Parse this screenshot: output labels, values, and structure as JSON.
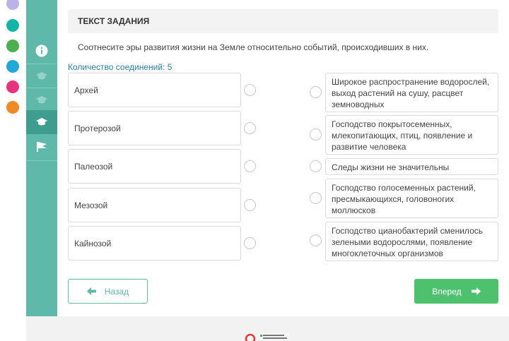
{
  "app_rail": {
    "icons": [
      "app-icon-1",
      "app-icon-2",
      "app-icon-3",
      "app-icon-4",
      "app-icon-5",
      "app-icon-6"
    ],
    "colors": [
      "#b9b3e6",
      "#15b3a3",
      "#4caf50",
      "#1fa8d8",
      "#e6347a",
      "#f08a24"
    ]
  },
  "task_nav": {
    "items": [
      "info-icon",
      "graduation-cap-icon",
      "graduation-cap-icon",
      "graduation-cap-icon",
      "flag-icon"
    ],
    "active_index": 3
  },
  "task": {
    "header": "ТЕКСТ ЗАДАНИЯ",
    "instruction": "Соотнесите эры развития жизни на Земле относительно событий, происходивших в них.",
    "connections_label": "Количество соединений: 5"
  },
  "left_items": [
    {
      "label": "Архей"
    },
    {
      "label": "Протерозой"
    },
    {
      "label": "Палеозой"
    },
    {
      "label": "Мезозой"
    },
    {
      "label": "Кайнозой"
    }
  ],
  "right_items": [
    {
      "label": "Широкое распространение водорослей, выход растений на сушу, расцвет земноводных"
    },
    {
      "label": "Господство покрытосеменных, млекопитающих, птиц, появление и развитие человека"
    },
    {
      "label": "Следы жизни не значительны"
    },
    {
      "label": "Господство голосеменных растений, пресмыкающихся, головоногих моллюсков"
    },
    {
      "label": "Господство цианобактерий сменилось зелеными водорослями, появление многоклеточных организмов"
    }
  ],
  "buttons": {
    "back_label": "Назад",
    "next_label": "Вперед"
  },
  "colors": {
    "accent": "#5fb9ab",
    "accent_dark": "#3f9d8f",
    "next_button": "#4ec16e",
    "link": "#2a7fa8"
  }
}
